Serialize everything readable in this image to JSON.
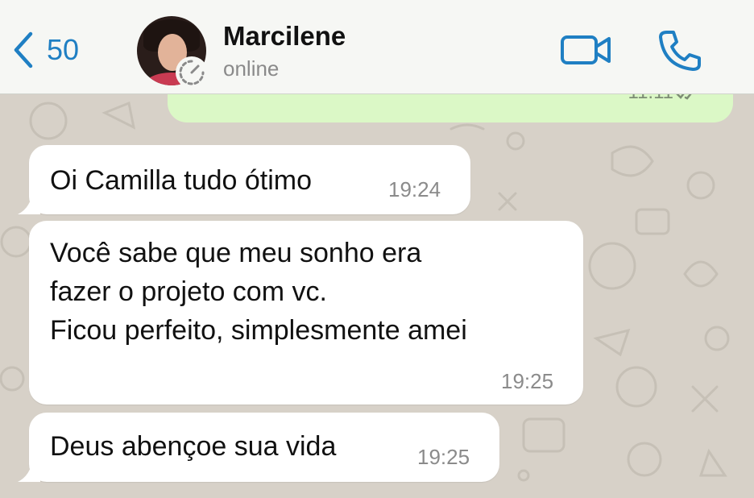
{
  "header": {
    "back_count": "50",
    "contact_name": "Marcilene",
    "contact_status": "online"
  },
  "outgoing_partial": {
    "time": "11:11"
  },
  "messages": [
    {
      "text": "Oi Camilla tudo ótimo",
      "time": "19:24"
    },
    {
      "text": "Você sabe que meu sonho era\nfazer o projeto com vc.\nFicou perfeito, simplesmente amei",
      "time": "19:25"
    },
    {
      "text": "Deus abençoe sua vida",
      "time": "19:25"
    }
  ],
  "icons": {
    "back": "chevron-left-icon",
    "status": "timer-icon",
    "video": "video-camera-icon",
    "call": "phone-icon"
  },
  "colors": {
    "accent": "#1f7fc3",
    "outgoing_bubble": "#dbf8c6",
    "incoming_bubble": "#ffffff",
    "wallpaper": "#d7d1c8"
  }
}
